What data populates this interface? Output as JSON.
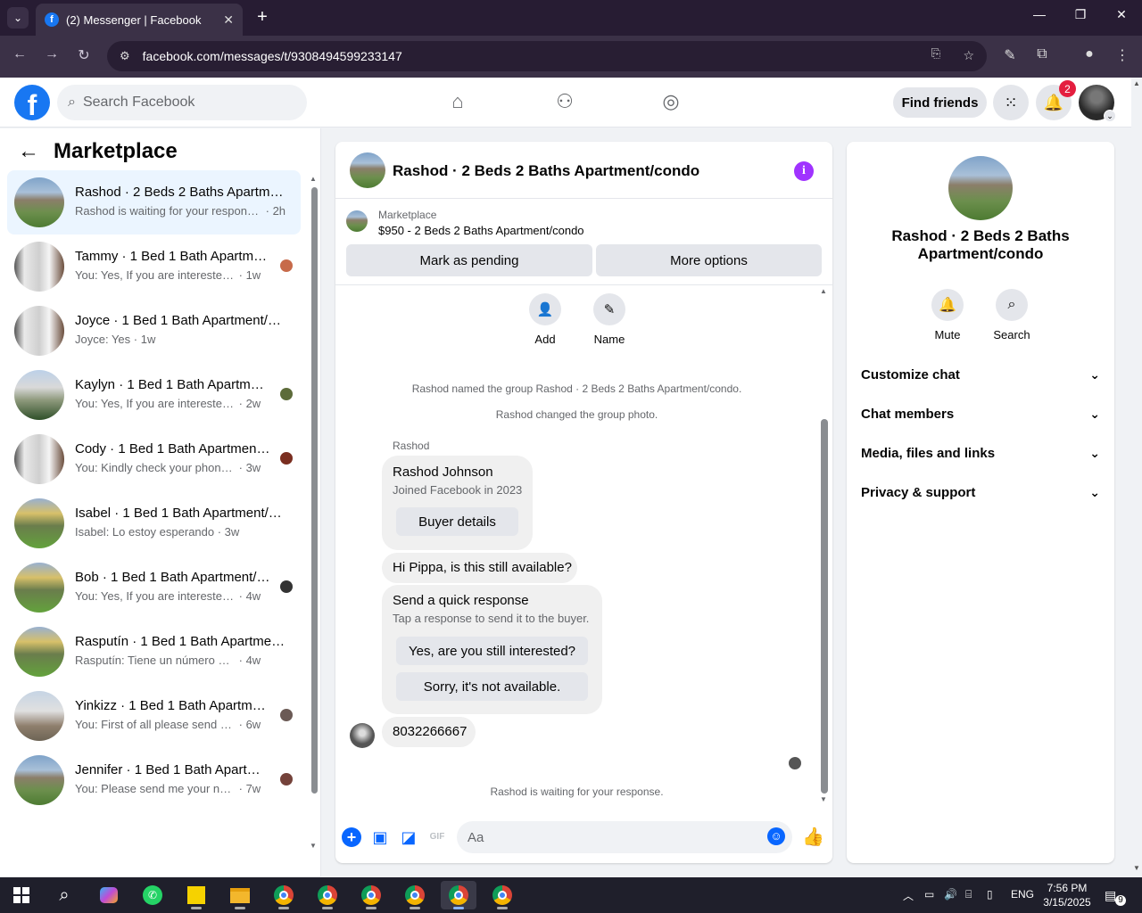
{
  "browser": {
    "tab_title": "(2) Messenger | Facebook",
    "tab_favicon": "f",
    "url": "facebook.com/messages/t/9308494599233147"
  },
  "header": {
    "search_placeholder": "Search Facebook",
    "find_friends": "Find friends",
    "notification_count": "2",
    "brand_color": "#1877f2"
  },
  "sidebar": {
    "title": "Marketplace",
    "conversations": [
      {
        "name": "Rashod · 2 Beds 2 Baths Apartment/condo",
        "snippet": "Rashod is waiting for your response.",
        "time": "2h",
        "active": true
      },
      {
        "name": "Tammy · 1 Bed 1 Bath Apartment/condo",
        "snippet": "You: Yes, If you are interested th...",
        "time": "1w"
      },
      {
        "name": "Joyce · 1 Bed 1 Bath Apartment/condo",
        "snippet": "Joyce: Yes",
        "time": "1w"
      },
      {
        "name": "Kaylyn · 1 Bed 1 Bath Apartment/condo",
        "snippet": "You: Yes, If you are interested th...",
        "time": "2w"
      },
      {
        "name": "Cody · 1 Bed 1 Bath Apartment/condo",
        "snippet": "You: Kindly check your phone a...",
        "time": "3w"
      },
      {
        "name": "Isabel · 1 Bed 1 Bath Apartment/condo",
        "snippet": "Isabel: Lo estoy esperando",
        "time": "3w"
      },
      {
        "name": "Bob · 1 Bed 1 Bath Apartment/condo",
        "snippet": "You: Yes, If you are interested th...",
        "time": "4w"
      },
      {
        "name": "Rasputín · 1 Bed 1 Bath Apartment/condo",
        "snippet": "Rasputín: Tiene un número donde ...",
        "time": "4w"
      },
      {
        "name": "Yinkizz · 1 Bed 1 Bath Apartment/condo",
        "snippet": "You: First of all please send me ...",
        "time": "6w"
      },
      {
        "name": "Jennifer · 1 Bed 1 Bath Apartment/condo",
        "snippet": "You: Please send me your numb...",
        "time": "7w"
      }
    ]
  },
  "chat": {
    "title": "Rashod · 2 Beds 2 Baths Apartment/condo",
    "marketplace_label": "Marketplace",
    "listing": "$950 - 2 Beds 2 Baths Apartment/condo",
    "mark_pending": "Mark as pending",
    "more_options": "More options",
    "actions": {
      "add": "Add",
      "name": "Name"
    },
    "system_messages": [
      "Rashod named the group Rashod · 2 Beds 2 Baths Apartment/condo.",
      "Rashod changed the group photo."
    ],
    "sender": "Rashod",
    "profile_card": {
      "name": "Rashod Johnson",
      "joined": "Joined Facebook in 2023",
      "button": "Buyer details"
    },
    "message1": "Hi Pippa, is this still available?",
    "quick_response": {
      "title": "Send a quick response",
      "subtitle": "Tap a response to send it to the buyer.",
      "option1": "Yes, are you still interested?",
      "option2": "Sorry, it's not available."
    },
    "message2": "8032266667",
    "waiting": "Rashod is waiting for your response.",
    "composer_placeholder": "Aa",
    "accent_color": "#0866ff"
  },
  "right_panel": {
    "name": "Rashod · 2 Beds 2 Baths Apartment/condo",
    "mute": "Mute",
    "search": "Search",
    "sections": [
      "Customize chat",
      "Chat members",
      "Media, files and links",
      "Privacy & support"
    ]
  },
  "taskbar": {
    "language": "ENG",
    "time": "7:56 PM",
    "date": "3/15/2025",
    "notifications": "9"
  }
}
